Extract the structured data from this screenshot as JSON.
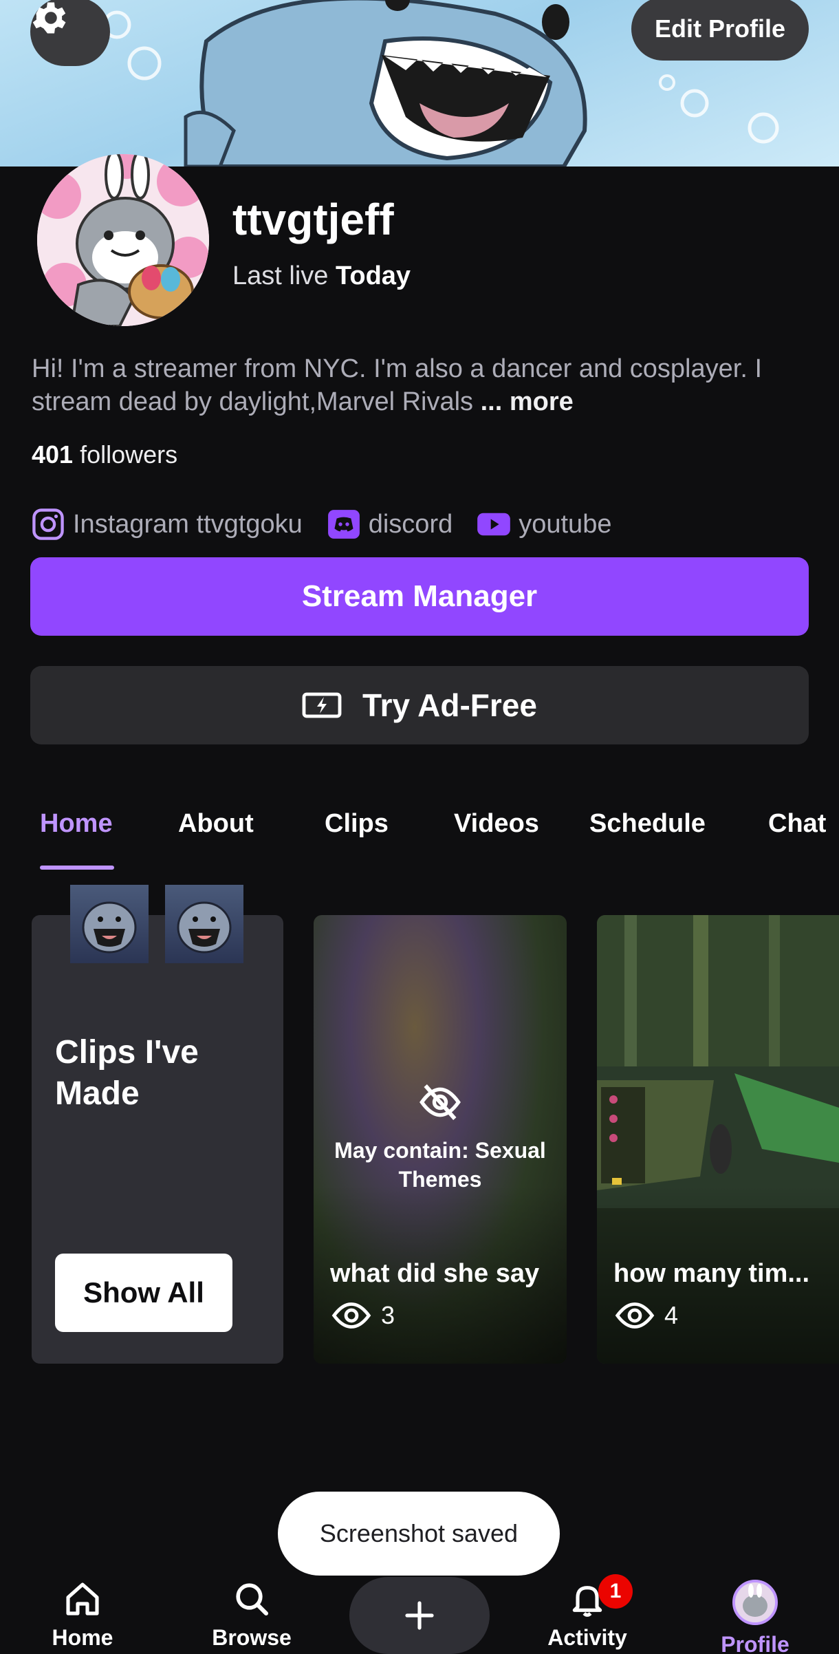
{
  "header": {
    "edit_profile_label": "Edit Profile",
    "settings_icon": "gear-icon"
  },
  "profile": {
    "username": "ttvgtjeff",
    "last_live_prefix": "Last live",
    "last_live_value": "Today",
    "bio": "Hi! I'm a streamer from NYC. I'm also a dancer and cosplayer. I stream dead by daylight,Marvel Rivals",
    "more_label": "... more",
    "followers_count": "401",
    "followers_label": "followers"
  },
  "socials": [
    {
      "icon": "instagram-icon",
      "label": "Instagram ttvgtgoku"
    },
    {
      "icon": "discord-icon",
      "label": "discord"
    },
    {
      "icon": "youtube-icon",
      "label": "youtube"
    }
  ],
  "actions": {
    "stream_manager_label": "Stream Manager",
    "ad_free_label": "Try Ad-Free"
  },
  "tabs": [
    {
      "label": "Home",
      "active": true
    },
    {
      "label": "About"
    },
    {
      "label": "Clips"
    },
    {
      "label": "Videos"
    },
    {
      "label": "Schedule"
    },
    {
      "label": "Chat"
    }
  ],
  "clips_card": {
    "title": "Clips I've Made",
    "show_all_label": "Show All"
  },
  "videos": [
    {
      "title": "what did she say",
      "views": "3",
      "warning": "May contain: Sexual Themes"
    },
    {
      "title": "how many tim...",
      "views": "4"
    }
  ],
  "toast": {
    "text": "Screenshot saved"
  },
  "bottom_nav": {
    "home_label": "Home",
    "browse_label": "Browse",
    "activity_label": "Activity",
    "activity_badge": "1",
    "profile_label": "Profile"
  },
  "colors": {
    "accent": "#9147ff",
    "accent_light": "#bf94ff",
    "background": "#0e0e10",
    "card": "#2f2f35",
    "badge": "#eb0400"
  }
}
